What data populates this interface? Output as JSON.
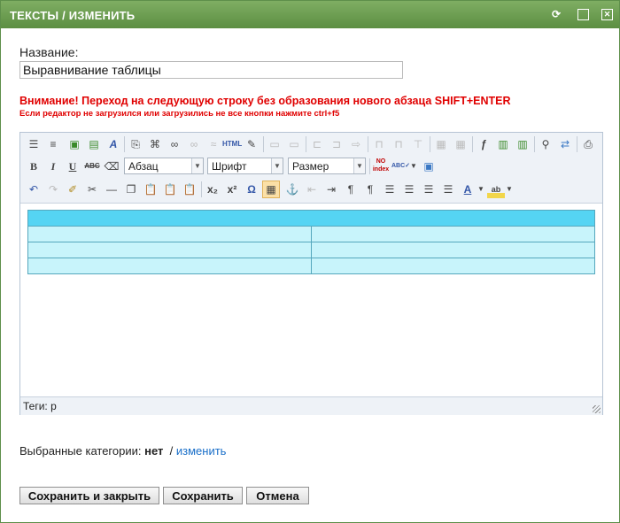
{
  "window": {
    "title": "ТЕКСТЫ / ИЗМЕНИТЬ"
  },
  "form": {
    "name_label": "Название:",
    "name_value": "Выравнивание таблицы",
    "warning_main": "Внимание! Переход на следующую строку без образования нового абзаца SHIFT+ENTER",
    "warning_sub": "Если редактор не загрузился или загрузились не все кнопки нажмите ctrl+f5"
  },
  "editor": {
    "selects": {
      "format": "Абзац",
      "font": "Шрифт",
      "size": "Размер"
    },
    "status_text": "Теги: p"
  },
  "categories": {
    "label": "Выбранные категории:",
    "value": "нет",
    "separator": "/",
    "change_link": "изменить"
  },
  "buttons": {
    "save_close": "Сохранить и закрыть",
    "save": "Сохранить",
    "cancel": "Отмена"
  }
}
